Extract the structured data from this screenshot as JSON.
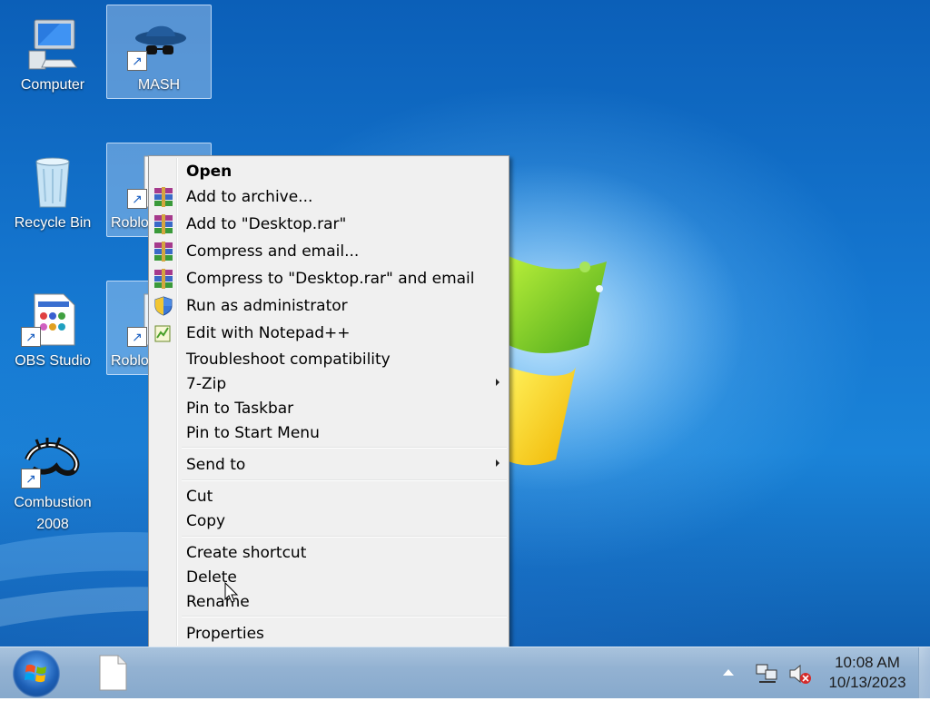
{
  "desktop": {
    "icons": [
      {
        "label": "Computer"
      },
      {
        "label": "MASH"
      },
      {
        "label": "Recycle Bin"
      },
      {
        "label": "Roblo"
      },
      {
        "label": "OBS Studio"
      },
      {
        "label": "Roblo"
      },
      {
        "label_line1": "Combustion",
        "label_line2": "2008"
      }
    ]
  },
  "context_menu": {
    "items": [
      {
        "label": "Open",
        "icon": "none"
      },
      {
        "label": "Add to archive...",
        "icon": "winrar-icon"
      },
      {
        "label": "Add to \"Desktop.rar\"",
        "icon": "winrar-icon"
      },
      {
        "label": "Compress and email...",
        "icon": "winrar-icon"
      },
      {
        "label": "Compress to \"Desktop.rar\" and email",
        "icon": "winrar-icon"
      },
      {
        "label": "Run as administrator",
        "icon": "uac-shield-icon"
      },
      {
        "label": "Edit with Notepad++",
        "icon": "notepadpp-icon"
      },
      {
        "label": "Troubleshoot compatibility",
        "icon": "none"
      },
      {
        "label": "7-Zip",
        "icon": "none",
        "submenu": true
      },
      {
        "label": "Pin to Taskbar",
        "icon": "none"
      },
      {
        "label": "Pin to Start Menu",
        "icon": "none"
      },
      {
        "label": "Send to",
        "icon": "none",
        "submenu": true
      },
      {
        "label": "Cut",
        "icon": "none"
      },
      {
        "label": "Copy",
        "icon": "none"
      },
      {
        "label": "Create shortcut",
        "icon": "none"
      },
      {
        "label": "Delete",
        "icon": "none"
      },
      {
        "label": "Rename",
        "icon": "none"
      },
      {
        "label": "Properties",
        "icon": "none"
      }
    ]
  },
  "taskbar": {
    "clock_time": "10:08 AM",
    "clock_date": "10/13/2023"
  },
  "colors": {
    "desktop_blue": "#1577d0",
    "menu_background": "#f0f0f0",
    "taskbar": "#93b2d2"
  }
}
